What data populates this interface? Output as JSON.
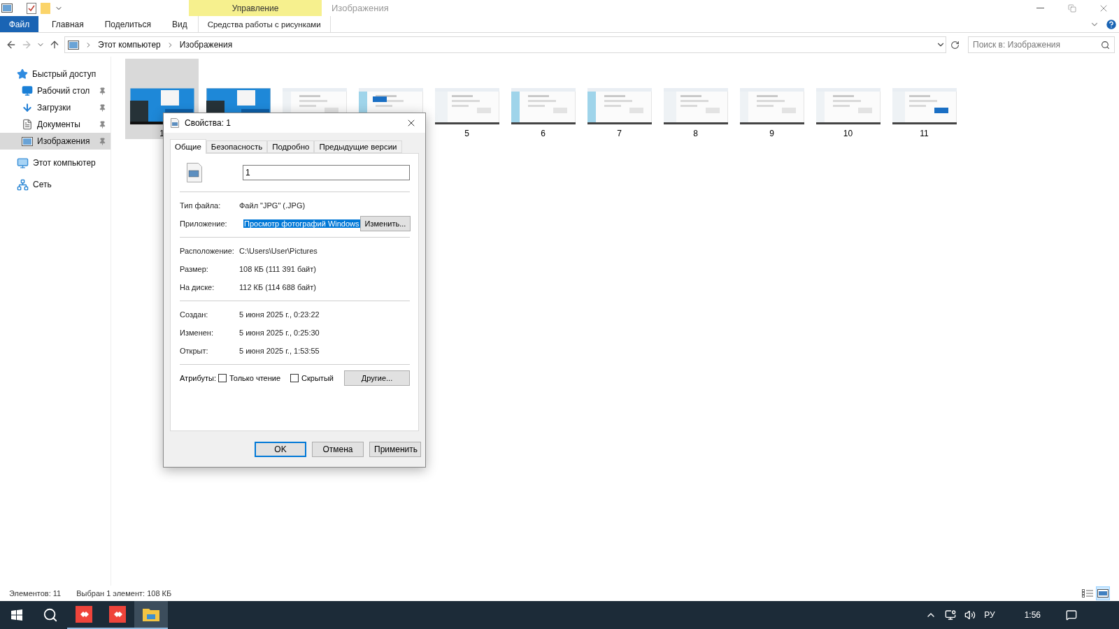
{
  "title_bar": {
    "context_group": "Управление",
    "window_title": "Изображения"
  },
  "ribbon": {
    "tabs": [
      {
        "label": "Файл",
        "kind": "file"
      },
      {
        "label": "Главная",
        "kind": "tab"
      },
      {
        "label": "Поделиться",
        "kind": "tab"
      },
      {
        "label": "Вид",
        "kind": "tab"
      },
      {
        "label": "Средства работы с рисунками",
        "kind": "context"
      }
    ]
  },
  "address_bar": {
    "path": [
      "Этот компьютер",
      "Изображения"
    ]
  },
  "search": {
    "placeholder": "Поиск в: Изображения"
  },
  "sidebar": {
    "items": [
      {
        "label": "Быстрый доступ",
        "kind": "star",
        "selected": false,
        "children": [
          {
            "label": "Рабочий стол",
            "kind": "desktop",
            "pinned": true,
            "selected": false
          },
          {
            "label": "Загрузки",
            "kind": "download",
            "pinned": true,
            "selected": false
          },
          {
            "label": "Документы",
            "kind": "document",
            "pinned": true,
            "selected": false
          },
          {
            "label": "Изображения",
            "kind": "pictures",
            "pinned": true,
            "selected": true
          }
        ]
      },
      {
        "label": "Этот компьютер",
        "kind": "computer",
        "selected": false
      },
      {
        "label": "Сеть",
        "kind": "network",
        "selected": false
      }
    ]
  },
  "files": [
    {
      "label": "1",
      "selected": true
    },
    {
      "selected": false
    },
    {
      "selected": false
    },
    {
      "selected": false
    },
    {
      "label": "5",
      "selected": false
    },
    {
      "label": "6",
      "selected": false
    },
    {
      "label": "7",
      "selected": false
    },
    {
      "label": "8",
      "selected": false
    },
    {
      "label": "9",
      "selected": false
    },
    {
      "label": "10",
      "selected": false
    },
    {
      "label": "11",
      "selected": false
    }
  ],
  "dialog": {
    "title": "Свойства: 1",
    "tabs": [
      {
        "label": "Общие",
        "selected": true
      },
      {
        "label": "Безопасность",
        "selected": false
      },
      {
        "label": "Подробно",
        "selected": false
      },
      {
        "label": "Предыдущие версии",
        "selected": false
      }
    ],
    "name_value": "1",
    "sections": [
      [
        {
          "label": "Тип файла:",
          "value": "Файл \"JPG\" (.JPG)",
          "kind": "text"
        },
        {
          "label": "Приложение:",
          "value": "Просмотр фотографий Windows",
          "kind": "app",
          "button": "Изменить..."
        }
      ],
      [
        {
          "label": "Расположение:",
          "value": "C:\\Users\\User\\Pictures",
          "kind": "text"
        },
        {
          "label": "Размер:",
          "value": "108 КБ (111 391 байт)",
          "kind": "text"
        },
        {
          "label": "На диске:",
          "value": "112 КБ (114 688 байт)",
          "kind": "text"
        }
      ],
      [
        {
          "label": "Создан:",
          "value": "5 июня 2025 г., 0:23:22",
          "kind": "text"
        },
        {
          "label": "Изменен:",
          "value": "5 июня 2025 г., 0:25:30",
          "kind": "text"
        },
        {
          "label": "Открыт:",
          "value": "5 июня 2025 г., 1:53:55",
          "kind": "text"
        }
      ]
    ],
    "attributes": {
      "label": "Атрибуты:",
      "checkboxes": [
        {
          "label": "Только чтение",
          "checked": false
        },
        {
          "label": "Скрытый",
          "checked": false
        }
      ],
      "button": "Другие..."
    },
    "buttons": [
      {
        "label": "OK",
        "default": true
      },
      {
        "label": "Отмена",
        "default": false
      },
      {
        "label": "Применить",
        "default": false
      }
    ]
  },
  "status_bar": {
    "count": "Элементов: 11",
    "selection": "Выбран 1 элемент: 108 КБ",
    "views": [
      {
        "kind": "details",
        "selected": false
      },
      {
        "kind": "thumbnails",
        "selected": true
      }
    ]
  },
  "taskbar": {
    "apps": [
      {
        "kind": "remote",
        "active": false
      },
      {
        "kind": "remote",
        "active": false
      },
      {
        "kind": "folder",
        "active": true
      }
    ],
    "tray": {
      "language": "РУ",
      "time": "1:56"
    }
  }
}
